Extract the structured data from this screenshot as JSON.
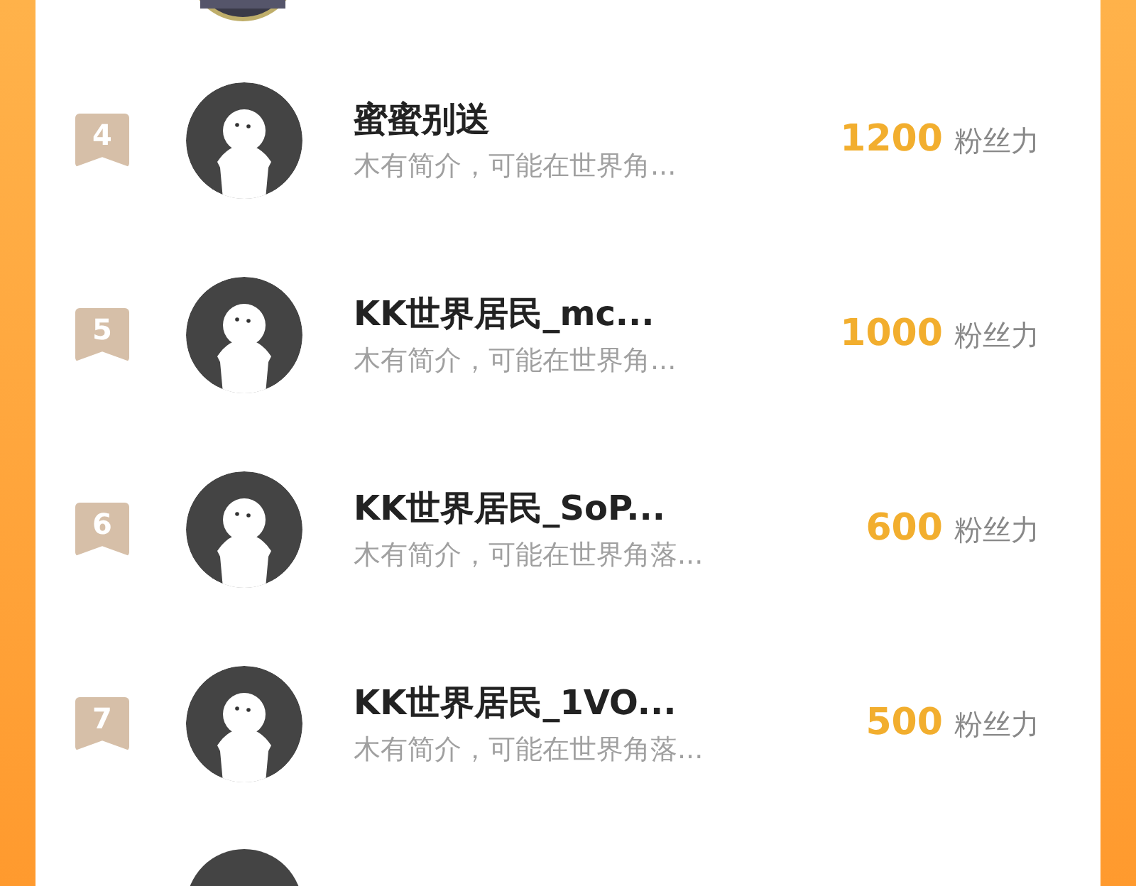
{
  "rows": [
    {
      "rank": "4",
      "name": "蜜蜜别送",
      "bio": "木有简介，可能在世界角...",
      "score": "1200",
      "score_unit": "粉丝力"
    },
    {
      "rank": "5",
      "name": "KK世界居民_mc...",
      "bio": "木有简介，可能在世界角...",
      "score": "1000",
      "score_unit": "粉丝力"
    },
    {
      "rank": "6",
      "name": "KK世界居民_SoP...",
      "bio": "木有简介，可能在世界角落...",
      "score": "600",
      "score_unit": "粉丝力"
    },
    {
      "rank": "7",
      "name": "KK世界居民_1VO...",
      "bio": "木有简介，可能在世界角落...",
      "score": "500",
      "score_unit": "粉丝力"
    }
  ]
}
